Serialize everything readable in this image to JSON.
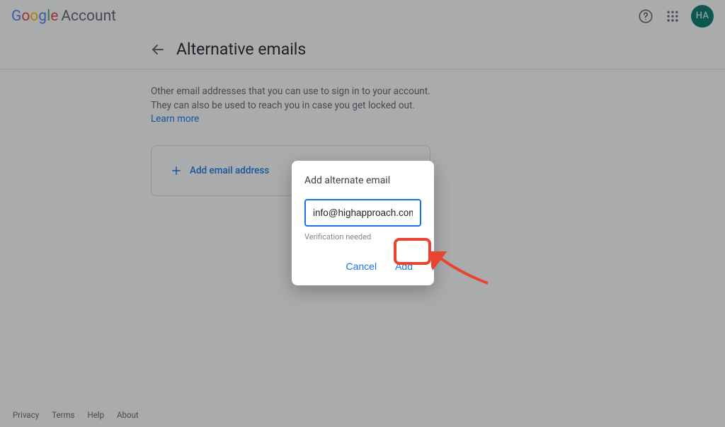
{
  "header": {
    "account_label": "Account",
    "avatar_initials": "HA"
  },
  "page": {
    "title": "Alternative emails",
    "description_part1": "Other email addresses that you can use to sign in to your account. They can also be used to reach you in case you get locked out. ",
    "learn_more": "Learn more",
    "add_email_label": "Add email address"
  },
  "dialog": {
    "title": "Add alternate email",
    "email_value": "info@highapproach.com",
    "hint": "Verification needed",
    "cancel_label": "Cancel",
    "add_label": "Add"
  },
  "footer": {
    "privacy": "Privacy",
    "terms": "Terms",
    "help": "Help",
    "about": "About"
  }
}
